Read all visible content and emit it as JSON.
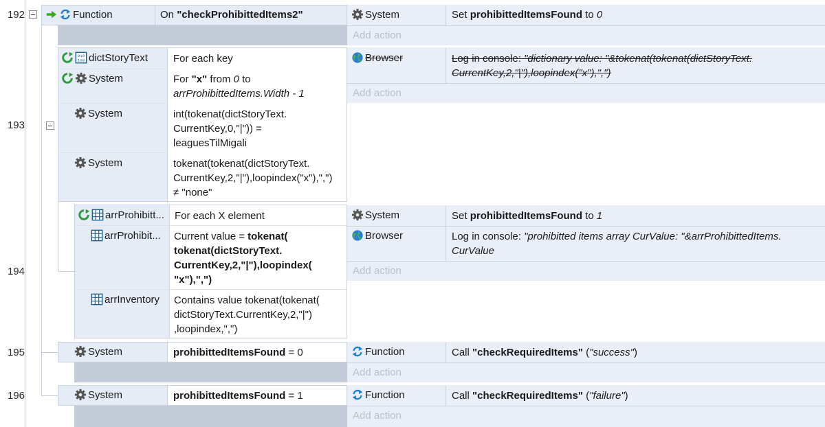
{
  "line_numbers": [
    "192",
    "193",
    "194",
    "195",
    "196"
  ],
  "add_action_label": "Add action",
  "e192": {
    "object": "Function",
    "condition_prefix": "On ",
    "condition_bold": "\"checkProhibittedItems2\"",
    "action_object": "System",
    "action_prefix": "Set ",
    "action_bold": "prohibittedItemsFound",
    "action_mid": " to ",
    "action_italic": "0"
  },
  "e193": {
    "cond1_object": "dictStoryText",
    "cond1_text": "For each key",
    "cond2_object": "System",
    "cond2_line1_prefix": "For ",
    "cond2_line1_bold": "\"x\"",
    "cond2_line1_mid": " from ",
    "cond2_line1_italic": "0",
    "cond2_line1_suffix": " to",
    "cond2_line2_italic": "arrProhibittedItems.Width - 1",
    "cond3_object": "System",
    "cond3_lines": [
      "int(tokenat(dictStoryText.",
      "CurrentKey,0,\"|\")) =",
      "leaguesTilMigali"
    ],
    "cond4_object": "System",
    "cond4_lines": [
      "tokenat(tokenat(dictStoryText.",
      "CurrentKey,2,\"|\"),loopindex(\"x\"),\",\")",
      "≠ \"none\""
    ],
    "action_object": "Browser",
    "action_line1_prefix": "Log in console: ",
    "action_line1_italic": "\"dictionary value: \"&tokenat(tokenat(dictStoryText.",
    "action_line2_italic": "CurrentKey,2,\"|\"),loopindex(\"x\"),\",\")"
  },
  "e194": {
    "cond1_object": "arrProhibitt...",
    "cond1_text": "For each X element",
    "cond2_object": "arrProhibit...",
    "cond2_prefix": "Current value = ",
    "cond2_bold_lines": [
      "tokenat(",
      "tokenat(dictStoryText.",
      "CurrentKey,2,\"|\"),loopindex(",
      "\"x\"),\",\")"
    ],
    "cond3_object": "arrInventory",
    "cond3_lines": [
      "Contains value tokenat(tokenat(",
      "dictStoryText.CurrentKey,2,\"|\")",
      ",loopindex,\",\")"
    ],
    "action1_object": "System",
    "action1_prefix": "Set ",
    "action1_bold": "prohibittedItemsFound",
    "action1_mid": " to ",
    "action1_italic": "1",
    "action2_object": "Browser",
    "action2_prefix": "Log in console: ",
    "action2_line1_italic": "\"prohibitted items array CurValue: \"&arrProhibittedItems.",
    "action2_line2_italic": "CurValue"
  },
  "e195": {
    "object": "System",
    "cond_bold": "prohibittedItemsFound",
    "cond_rest": " = 0",
    "action_object": "Function",
    "action_prefix": "Call ",
    "action_bold": "\"checkRequiredItems\"",
    "action_open": " (",
    "action_italic": "\"success\"",
    "action_close": ")"
  },
  "e196": {
    "object": "System",
    "cond_bold": "prohibittedItemsFound",
    "cond_rest": " = 1",
    "action_object": "Function",
    "action_prefix": "Call ",
    "action_bold": "\"checkRequiredItems\"",
    "action_open": " (",
    "action_italic": "\"failure\"",
    "action_close": ")"
  }
}
